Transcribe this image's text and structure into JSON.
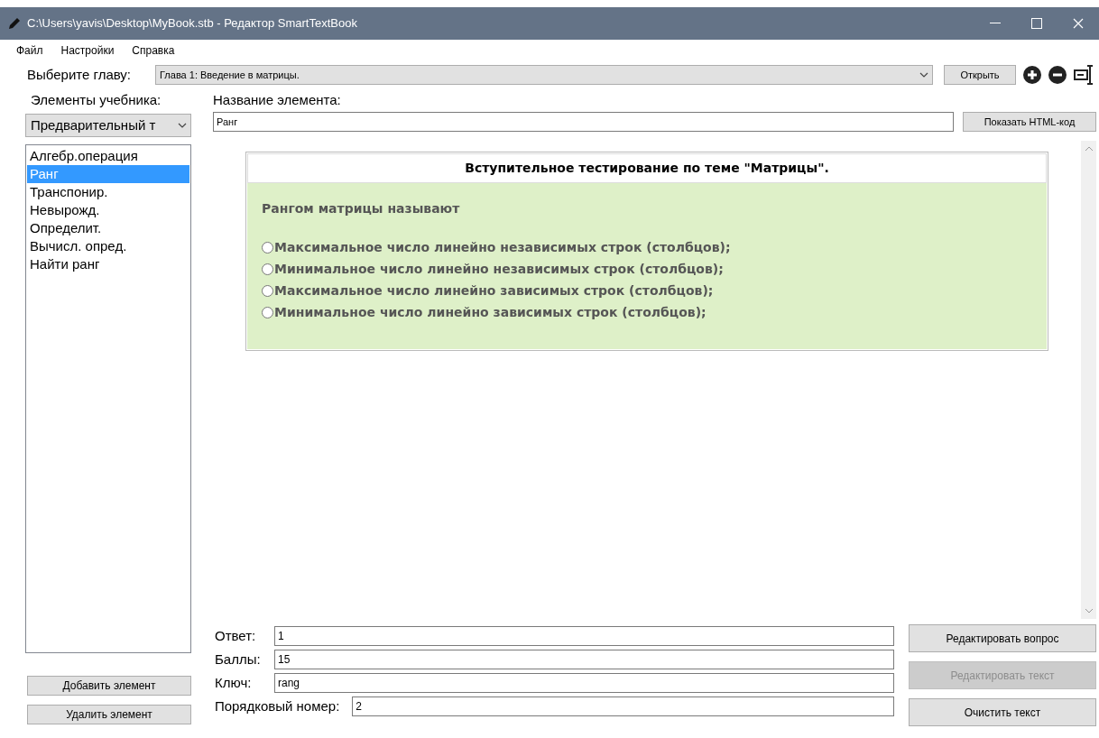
{
  "window": {
    "title": "C:\\Users\\yavis\\Desktop\\MyBook.stb - Редактор SmartTextBook"
  },
  "menu": [
    "Файл",
    "Настройки",
    "Справка"
  ],
  "chapter": {
    "label": "Выберите главу:",
    "value": "Глава 1: Введение в матрицы.",
    "open_button": "Открыть"
  },
  "sidebar": {
    "label": "Элементы учебника:",
    "type_value": "Предварительный т",
    "items": [
      {
        "label": "Алгебр.операция",
        "selected": false
      },
      {
        "label": "Ранг",
        "selected": true
      },
      {
        "label": "Транспонир.",
        "selected": false
      },
      {
        "label": "Невырожд.",
        "selected": false
      },
      {
        "label": "Определит.",
        "selected": false
      },
      {
        "label": "Вычисл. опред.",
        "selected": false
      },
      {
        "label": "Найти ранг",
        "selected": false
      }
    ],
    "buttons": [
      "Добавить элемент",
      "Удалить элемент"
    ]
  },
  "element_name": {
    "label": "Название элемента:",
    "value": "Ранг",
    "html_button": "Показать HTML-код"
  },
  "preview": {
    "title": "Вступительное тестирование по теме \"Матрицы\".",
    "question": "Рангом матрицы называют",
    "options": [
      {
        "label": "Максимальное число линейно независимых строк (столбцов);",
        "selected": false
      },
      {
        "label": "Минимальное число линейно независимых строк (столбцов);",
        "selected": false
      },
      {
        "label": "Максимальное число линейно зависимых строк (столбцов);",
        "selected": false
      },
      {
        "label": "Минимальное число линейно зависимых строк (столбцов);",
        "selected": false
      }
    ]
  },
  "fields": [
    {
      "label": "Ответ:",
      "value": "1"
    },
    {
      "label": "Баллы:",
      "value": "15"
    },
    {
      "label": "Ключ:",
      "value": "rang"
    },
    {
      "label": "Порядковый номер:",
      "value": "2"
    }
  ],
  "actions": [
    {
      "label": "Редактировать вопрос",
      "disabled": false
    },
    {
      "label": "Редактировать текст",
      "disabled": true
    },
    {
      "label": "Очистить текст",
      "disabled": false
    }
  ]
}
